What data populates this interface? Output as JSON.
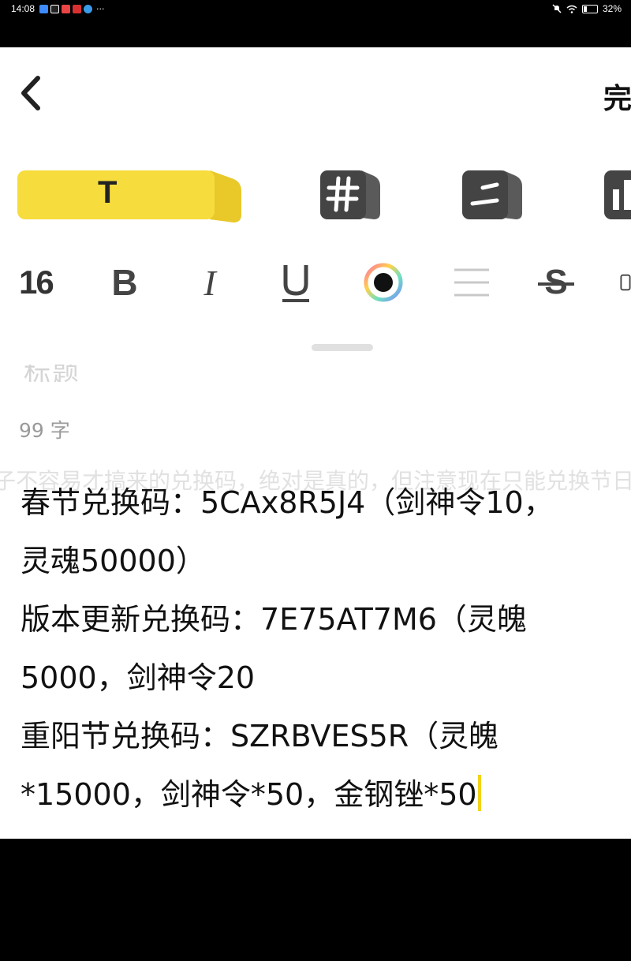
{
  "status_bar": {
    "time": "14:08",
    "battery": "32%",
    "battery_level": 0.32,
    "more": "···"
  },
  "toolbar": {
    "done_label": "完成"
  },
  "format_bar": {
    "font_size": "16",
    "bold": "B",
    "italic": "I",
    "underline": "U",
    "strike": "S"
  },
  "editor": {
    "title_partial": "标题",
    "word_count": "99 字",
    "ghost_line": "子不容易才搞来的兑换码，绝对是真的，但注意现在只能兑换节日的，",
    "lines": [
      "春节兑换码：5CAx8R5J4（剑神令10，",
      "灵魂50000）",
      "版本更新兑换码：7E75AT7M6（灵魄",
      "5000，剑神令20",
      "重阳节兑换码：SZRBVES5R（灵魄",
      "*15000，剑神令*50，金钢锉*50"
    ]
  },
  "colors": {
    "accent_yellow": "#f6dc3c",
    "icon_gray": "#444444"
  }
}
